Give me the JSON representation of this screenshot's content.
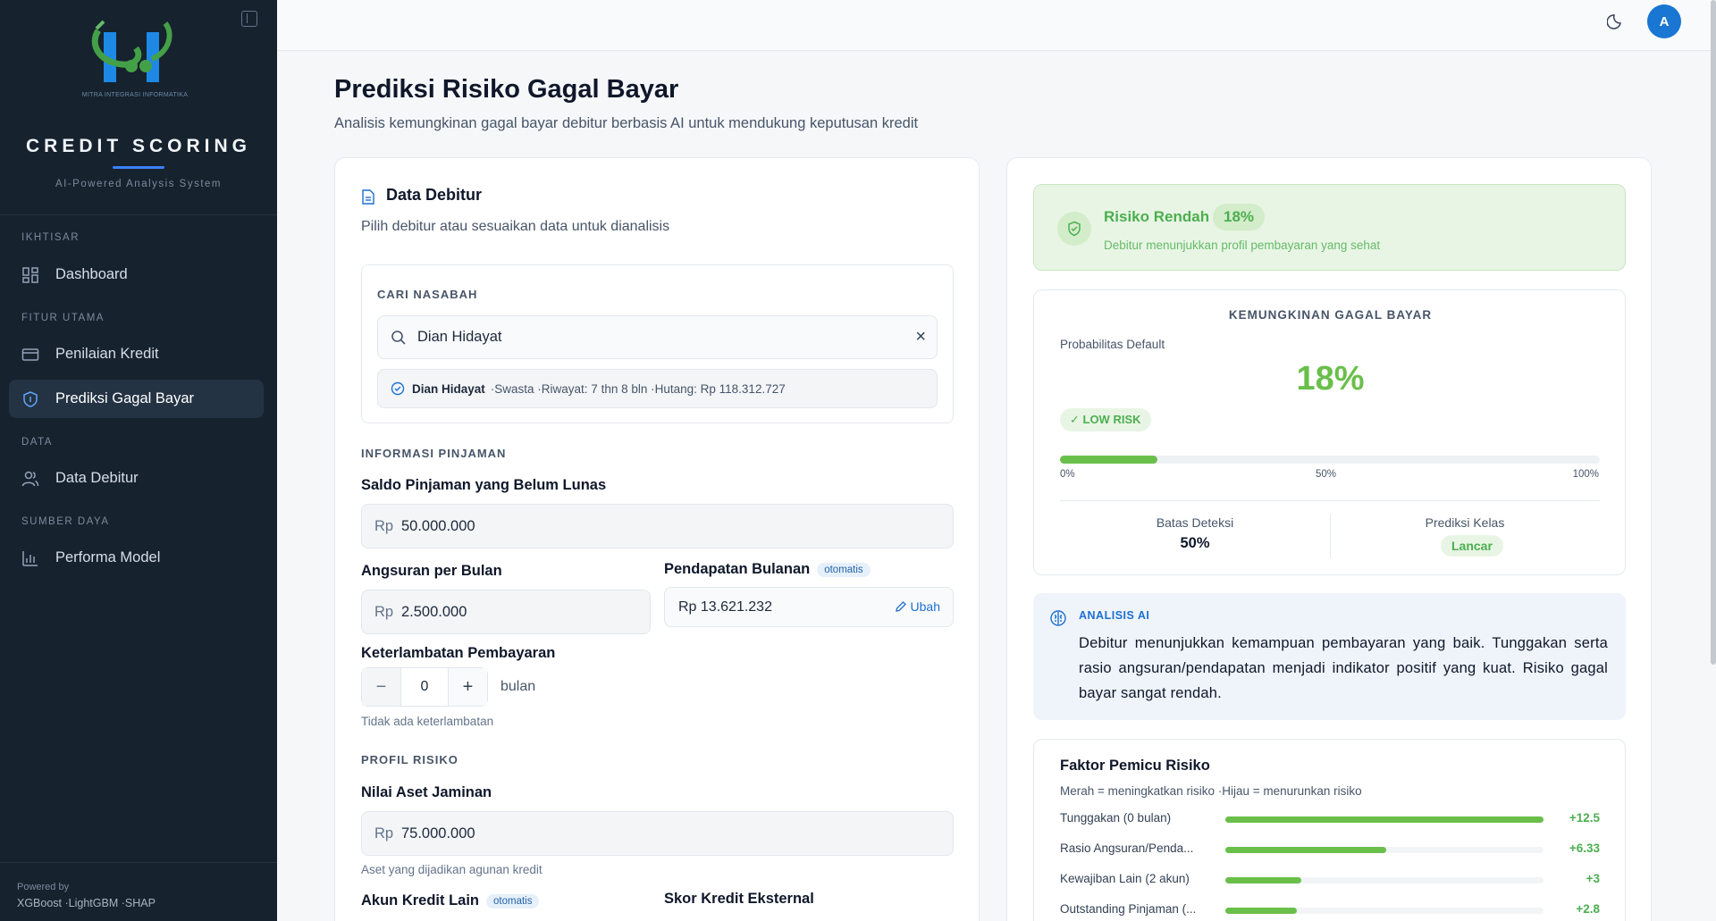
{
  "sidebar": {
    "logo_caption": "MITRA INTEGRASI INFORMATIKA",
    "brand": "CREDIT SCORING",
    "tagline": "AI-Powered Analysis System",
    "sections": [
      {
        "title": "IKHTISAR",
        "items": [
          {
            "label": "Dashboard",
            "icon": "grid-icon"
          }
        ]
      },
      {
        "title": "FITUR UTAMA",
        "items": [
          {
            "label": "Penilaian Kredit",
            "icon": "credit-card-icon"
          },
          {
            "label": "Prediksi Gagal Bayar",
            "icon": "shield-icon",
            "active": true
          }
        ]
      },
      {
        "title": "DATA",
        "items": [
          {
            "label": "Data Debitur",
            "icon": "users-icon"
          }
        ]
      },
      {
        "title": "SUMBER DAYA",
        "items": [
          {
            "label": "Performa Model",
            "icon": "bar-chart-icon"
          }
        ]
      }
    ],
    "powered_by_label": "Powered by",
    "powered_by_stack": "XGBoost ·LightGBM ·SHAP"
  },
  "topbar": {
    "avatar_initial": "A"
  },
  "header": {
    "title": "Prediksi Risiko Gagal Bayar",
    "subtitle": "Analisis kemungkinan gagal bayar debitur berbasis AI untuk mendukung keputusan kredit"
  },
  "form": {
    "title": "Data Debitur",
    "subtitle": "Pilih debitur atau sesuaikan data untuk dianalisis",
    "search": {
      "label": "CARI NASABAH",
      "value": "Dian Hidayat",
      "selected_name": "Dian Hidayat",
      "selected_details": "·Swasta ·Riwayat: 7 thn 8 bln ·Hutang: Rp 118.312.727"
    },
    "loan_section": "INFORMASI PINJAMAN",
    "saldo_label": "Saldo Pinjaman yang Belum Lunas",
    "currency_prefix": "Rp",
    "saldo_value": "50.000.000",
    "angsuran_label": "Angsuran per Bulan",
    "angsuran_value": "2.500.000",
    "pendapatan_label": "Pendapatan Bulanan",
    "auto_badge": "otomatis",
    "pendapatan_value": "Rp 13.621.232",
    "ubah_label": "Ubah",
    "keterlambatan_label": "Keterlambatan Pembayaran",
    "keterlambatan_value": "0",
    "keterlambatan_unit": "bulan",
    "keterlambatan_hint": "Tidak ada keterlambatan",
    "risk_section": "PROFIL RISIKO",
    "aset_label": "Nilai Aset Jaminan",
    "aset_value": "75.000.000",
    "aset_hint": "Aset yang dijadikan agunan kredit",
    "akun_label": "Akun Kredit Lain",
    "skor_label": "Skor Kredit Eksternal"
  },
  "result": {
    "risk_title": "Risiko Rendah",
    "risk_pct": "18%",
    "risk_desc": "Debitur menunjukkan profil pembayaran yang sehat",
    "prob_heading": "KEMUNGKINAN GAGAL BAYAR",
    "prob_label": "Probabilitas Default",
    "prob_value": "18%",
    "prob_fraction": 0.18,
    "risk_badge": "✓ LOW RISK",
    "ticks": [
      "0%",
      "50%",
      "100%"
    ],
    "batas_label": "Batas Deteksi",
    "batas_value": "50%",
    "kelas_label": "Prediksi Kelas",
    "kelas_value": "Lancar",
    "ai_label": "ANALISIS AI",
    "ai_text": "Debitur menunjukkan kemampuan pembayaran yang baik. Tunggakan serta rasio angsuran/pendapatan menjadi indikator positif yang kuat. Risiko gagal bayar sangat rendah.",
    "factors_title": "Faktor Pemicu Risiko",
    "factors_sub": "Merah = meningkatkan risiko ·Hijau = menurunkan risiko",
    "factors": [
      {
        "name": "Tunggakan (0 bulan)",
        "value": "+12.5",
        "magnitude": 12.5
      },
      {
        "name": "Rasio Angsuran/Penda...",
        "value": "+6.33",
        "magnitude": 6.33
      },
      {
        "name": "Kewajiban Lain (2 akun)",
        "value": "+3",
        "magnitude": 3
      },
      {
        "name": "Outstanding Pinjaman (...",
        "value": "+2.8",
        "magnitude": 2.8
      }
    ]
  },
  "colors": {
    "accent": "#1976d2",
    "success": "#6abf4b",
    "sidebar": "#16222e"
  }
}
